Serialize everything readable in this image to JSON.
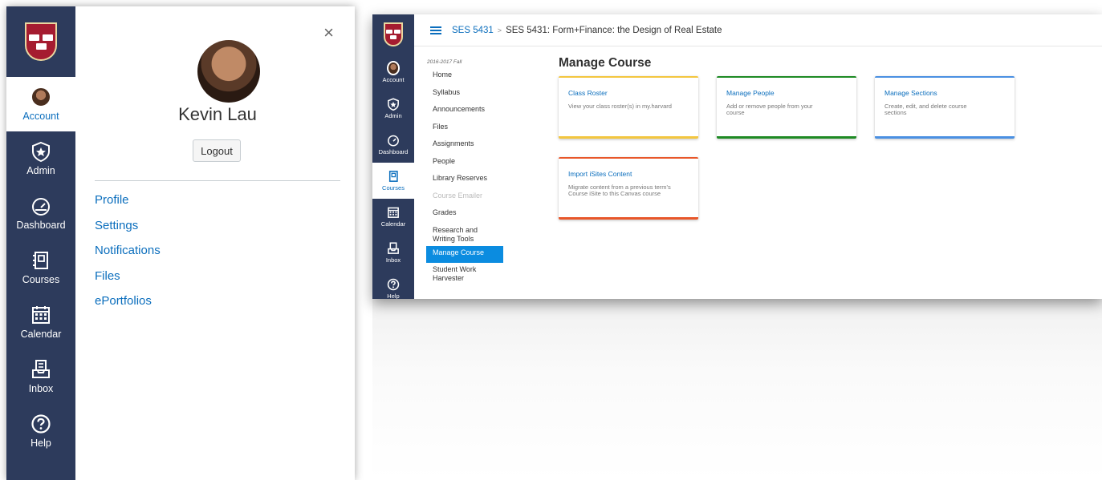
{
  "left_panel": {
    "nav": {
      "items": [
        {
          "label": "Account",
          "icon": "avatar"
        },
        {
          "label": "Admin",
          "icon": "admin-shield-star-icon"
        },
        {
          "label": "Dashboard",
          "icon": "dashboard-gauge-icon"
        },
        {
          "label": "Courses",
          "icon": "courses-book-icon"
        },
        {
          "label": "Calendar",
          "icon": "calendar-icon"
        },
        {
          "label": "Inbox",
          "icon": "inbox-icon"
        },
        {
          "label": "Help",
          "icon": "help-question-icon"
        }
      ],
      "active": "Account"
    },
    "tray": {
      "user_name": "Kevin Lau",
      "logout_label": "Logout",
      "close_glyph": "×",
      "links": [
        "Profile",
        "Settings",
        "Notifications",
        "Files",
        "ePortfolios"
      ]
    }
  },
  "right_panel": {
    "breadcrumb": {
      "course_code": "SES 5431",
      "separator": ">",
      "current": "SES 5431: Form+Finance: the Design of Real Estate"
    },
    "nav": {
      "items": [
        {
          "label": "Account",
          "icon": "avatar"
        },
        {
          "label": "Admin",
          "icon": "admin-shield-star-icon"
        },
        {
          "label": "Dashboard",
          "icon": "dashboard-gauge-icon"
        },
        {
          "label": "Courses",
          "icon": "courses-book-icon"
        },
        {
          "label": "Calendar",
          "icon": "calendar-icon"
        },
        {
          "label": "Inbox",
          "icon": "inbox-icon"
        },
        {
          "label": "Help",
          "icon": "help-question-icon"
        }
      ],
      "active": "Courses"
    },
    "course_nav": {
      "term": "2016-2017 Fall",
      "items": [
        {
          "label": "Home"
        },
        {
          "label": "Syllabus"
        },
        {
          "label": "Announcements"
        },
        {
          "label": "Files"
        },
        {
          "label": "Assignments"
        },
        {
          "label": "People"
        },
        {
          "label": "Library Reserves"
        },
        {
          "label": "Course Emailer",
          "muted": true
        },
        {
          "label": "Grades"
        },
        {
          "label": "Research and Writing Tools"
        },
        {
          "label": "Manage Course",
          "active": true
        },
        {
          "label": "Student Work Harvester"
        }
      ]
    },
    "page_title": "Manage Course",
    "cards": [
      {
        "title": "Class Roster",
        "desc": "View your class roster(s) in my.harvard",
        "color": "#f3c63f"
      },
      {
        "title": "Manage People",
        "desc": "Add or remove people from your course",
        "color": "#1e8a24"
      },
      {
        "title": "Manage Sections",
        "desc": "Create, edit, and delete course sections",
        "color": "#4a90e2"
      },
      {
        "title": "Import iSites Content",
        "desc": "Migrate content from a previous term's Course iSite to this Canvas course",
        "color": "#e8572a"
      }
    ]
  },
  "colors": {
    "nav_bg": "#2d3b5c",
    "link": "#0b6ebd",
    "active_item": "#0b8ce0"
  }
}
